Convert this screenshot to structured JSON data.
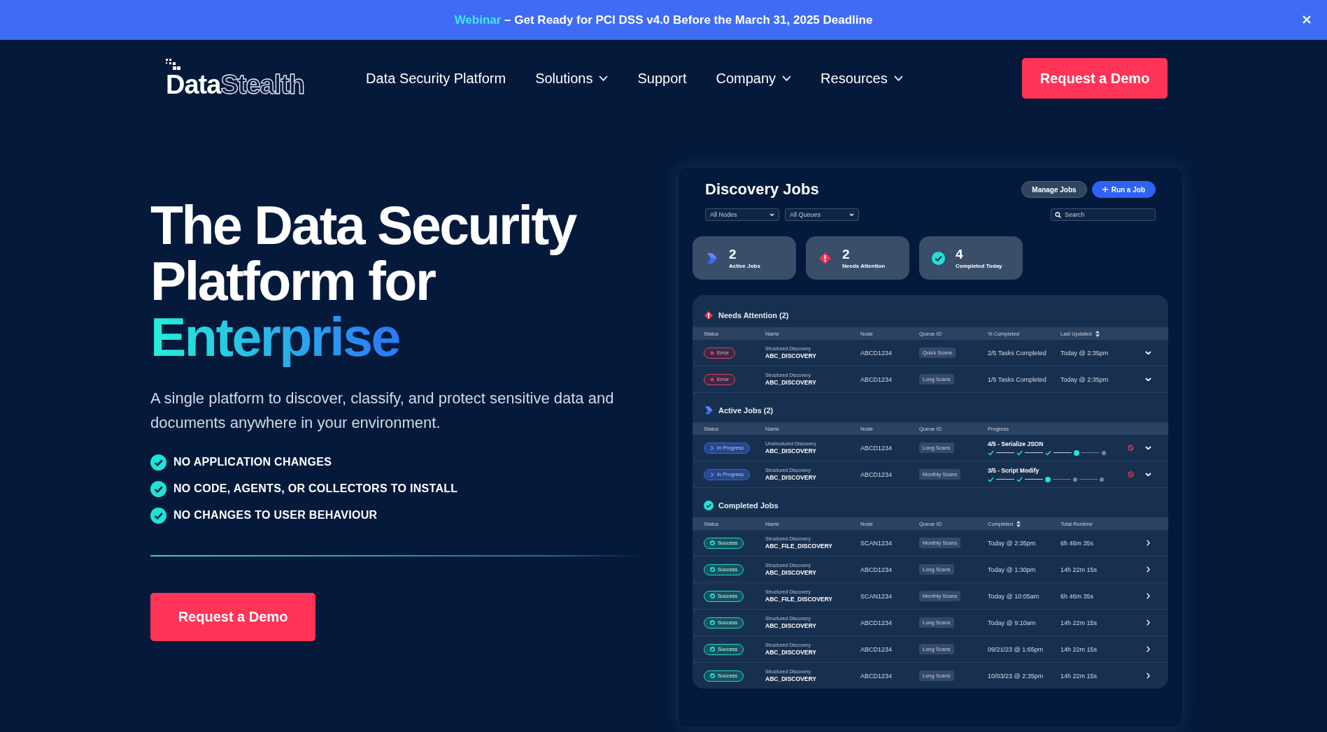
{
  "banner": {
    "highlight": "Webinar",
    "text": " – Get Ready for PCI DSS v4.0 Before the March 31, 2025 Deadline"
  },
  "nav": {
    "logo": {
      "solid": "Data",
      "outline": "Stealth"
    },
    "items": [
      {
        "label": "Data Security Platform",
        "dropdown": false
      },
      {
        "label": "Solutions",
        "dropdown": true
      },
      {
        "label": "Support",
        "dropdown": false
      },
      {
        "label": "Company",
        "dropdown": true
      },
      {
        "label": "Resources",
        "dropdown": true
      }
    ],
    "cta": "Request a Demo"
  },
  "hero": {
    "title_lines": [
      "The Data Security",
      "Platform for"
    ],
    "highlight": "Enterprise",
    "subtitle": "A single platform to discover, classify, and protect sensitive data and documents anywhere in your environment.",
    "features": [
      "NO APPLICATION CHANGES",
      "NO CODE, AGENTS, OR COLLECTORS TO INSTALL",
      "NO CHANGES TO USER BEHAVIOUR"
    ],
    "cta": "Request a Demo"
  },
  "dashboard": {
    "title": "Discovery Jobs",
    "buttons": [
      {
        "label": "Manage Jobs",
        "kind": "secondary"
      },
      {
        "label": "Run a Job",
        "kind": "primary"
      }
    ],
    "filters": [
      {
        "label": "All Nodes"
      },
      {
        "label": "All Queues"
      }
    ],
    "search": {
      "placeholder": "Search"
    },
    "stats": [
      {
        "value": "2",
        "label": "Active Jobs",
        "kind": "active"
      },
      {
        "value": "2",
        "label": "Needs Attention",
        "kind": "attention"
      },
      {
        "value": "4",
        "label": "Completed Today",
        "kind": "completed"
      }
    ],
    "sections": [
      {
        "kind": "attention",
        "title": "Needs Attention (2)",
        "columns": [
          {
            "label": "Status",
            "sortable": false
          },
          {
            "label": "Name",
            "sortable": false
          },
          {
            "label": "Node",
            "sortable": false
          },
          {
            "label": "Queue ID",
            "sortable": false
          },
          {
            "label": "% Completed",
            "sortable": false
          },
          {
            "label": "Last Updated",
            "sortable": true
          }
        ],
        "rows": [
          {
            "status": {
              "label": "Error",
              "kind": "error"
            },
            "type": "Structured Discovery",
            "name": "ABC_DISCOVERY",
            "node": "ABCD1234",
            "queue": "Quick Scans",
            "col5": "2/5 Tasks Completed",
            "col6": "Today @ 2:35pm"
          },
          {
            "status": {
              "label": "Error",
              "kind": "error"
            },
            "type": "Structured Discovery",
            "name": "ABC_DISCOVERY",
            "node": "ABCD1234",
            "queue": "Long Scans",
            "col5": "1/5 Tasks Completed",
            "col6": "Today @ 2:35pm"
          }
        ]
      },
      {
        "kind": "active",
        "title": "Active Jobs (2)",
        "columns": [
          {
            "label": "Status",
            "sortable": false
          },
          {
            "label": "Name",
            "sortable": false
          },
          {
            "label": "Node",
            "sortable": false
          },
          {
            "label": "Queue ID",
            "sortable": false
          },
          {
            "label": "Progress",
            "sortable": false
          }
        ],
        "rows": [
          {
            "status": {
              "label": "In Progress",
              "kind": "progress"
            },
            "type": "Unstructured Discovery",
            "name": "ABC_DISCOVERY",
            "node": "ABCD1234",
            "queue": "Long Scans",
            "step": "4/5 - Serialize JSON",
            "steps": [
              {
                "kind": "done"
              },
              {
                "kind": "done"
              },
              {
                "kind": "done"
              },
              {
                "kind": "current"
              },
              {
                "kind": "pending"
              }
            ]
          },
          {
            "status": {
              "label": "In Progress",
              "kind": "progress"
            },
            "type": "Structured Discovery",
            "name": "ABC_DISCOVERY",
            "node": "ABCD1234",
            "queue": "Monthly Scans",
            "step": "3/5 - Script Modify",
            "steps": [
              {
                "kind": "done"
              },
              {
                "kind": "done"
              },
              {
                "kind": "current"
              },
              {
                "kind": "pending"
              },
              {
                "kind": "pending"
              }
            ]
          }
        ]
      },
      {
        "kind": "completed",
        "title": "Completed Jobs",
        "columns": [
          {
            "label": "Status",
            "sortable": false
          },
          {
            "label": "Name",
            "sortable": false
          },
          {
            "label": "Node",
            "sortable": false
          },
          {
            "label": "Queue ID",
            "sortable": false
          },
          {
            "label": "Completed",
            "sortable": true
          },
          {
            "label": "Total Runtime",
            "sortable": false
          }
        ],
        "rows": [
          {
            "status": {
              "label": "Success",
              "kind": "success"
            },
            "type": "Structured Discovery",
            "name": "ABC_FILE_DISCOVERY",
            "node": "SCAN1234",
            "queue": "Monthly Scans",
            "col5": "Today @ 2:35pm",
            "col6": "6h 46m 35s"
          },
          {
            "status": {
              "label": "Success",
              "kind": "success"
            },
            "type": "Structured Discovery",
            "name": "ABC_DISCOVERY",
            "node": "ABCD1234",
            "queue": "Long Scans",
            "col5": "Today @ 1:30pm",
            "col6": "14h 22m 15s"
          },
          {
            "status": {
              "label": "Success",
              "kind": "success"
            },
            "type": "Structured Discovery",
            "name": "ABC_FILE_DISCOVERY",
            "node": "SCAN1234",
            "queue": "Monthly Scans",
            "col5": "Today @ 10:05am",
            "col6": "6h 46m 35s"
          },
          {
            "status": {
              "label": "Success",
              "kind": "success"
            },
            "type": "Structured Discovery",
            "name": "ABC_DISCOVERY",
            "node": "ABCD1234",
            "queue": "Long Scans",
            "col5": "Today @ 9:10am",
            "col6": "14h 22m 15s"
          },
          {
            "status": {
              "label": "Success",
              "kind": "success"
            },
            "type": "Structured Discovery",
            "name": "ABC_DISCOVERY",
            "node": "ABCD1234",
            "queue": "Long Scans",
            "col5": "09/21/23 @ 1:65pm",
            "col6": "14h 22m 15s"
          },
          {
            "status": {
              "label": "Success",
              "kind": "success"
            },
            "type": "Structured Discovery",
            "name": "ABC_DISCOVERY",
            "node": "ABCD1234",
            "queue": "Long Scans",
            "col5": "10/03/23 @ 2:35pm",
            "col6": "14h 22m 15s"
          }
        ]
      }
    ]
  }
}
